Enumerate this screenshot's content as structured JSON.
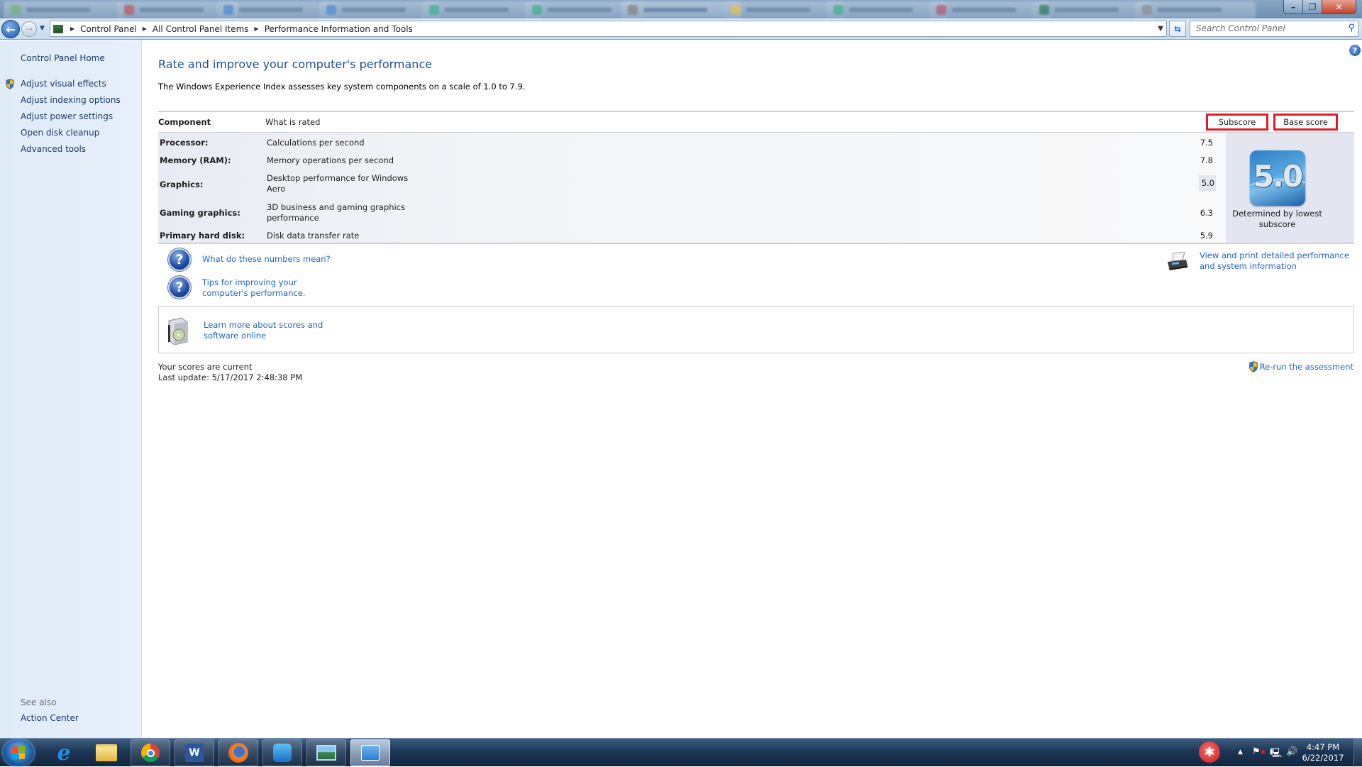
{
  "window": {
    "title_tabs_blurred": true,
    "controls": {
      "minimize": "–",
      "maximize": "❐",
      "close": "✕"
    }
  },
  "navbar": {
    "back_icon": "back-arrow-icon",
    "forward_icon": "forward-arrow-icon",
    "breadcrumbs": [
      "Control Panel",
      "All Control Panel Items",
      "Performance Information and Tools"
    ],
    "search_placeholder": "Search Control Panel"
  },
  "sidebar": {
    "home": "Control Panel Home",
    "items": [
      {
        "label": "Adjust visual effects",
        "shield": true
      },
      {
        "label": "Adjust indexing options",
        "shield": false
      },
      {
        "label": "Adjust power settings",
        "shield": false
      },
      {
        "label": "Open disk cleanup",
        "shield": false
      },
      {
        "label": "Advanced tools",
        "shield": false
      }
    ],
    "see_also_label": "See also",
    "see_also_items": [
      "Action Center"
    ]
  },
  "main": {
    "title": "Rate and improve your computer's performance",
    "intro": "The Windows Experience Index assesses key system components on a scale of 1.0 to 7.9.",
    "table": {
      "headers": {
        "component": "Component",
        "what": "What is rated",
        "subscore": "Subscore",
        "base": "Base score"
      },
      "rows": [
        {
          "component": "Processor:",
          "what": "Calculations per second",
          "subscore": "7.5"
        },
        {
          "component": "Memory (RAM):",
          "what": "Memory operations per second",
          "subscore": "7.8"
        },
        {
          "component": "Graphics:",
          "what": "Desktop performance for Windows Aero",
          "subscore": "5.0",
          "lowest": true
        },
        {
          "component": "Gaming graphics:",
          "what": "3D business and gaming graphics performance",
          "subscore": "6.3"
        },
        {
          "component": "Primary hard disk:",
          "what": "Disk data transfer rate",
          "subscore": "5.9"
        }
      ],
      "base_score": "5.0",
      "base_caption": "Determined by lowest subscore"
    },
    "links": {
      "numbers": "What do these numbers mean?",
      "tips": "Tips for improving your computer's performance.",
      "print": "View and print detailed performance and system information",
      "learn": "Learn more about scores and software online",
      "rerun": "Re-run the assessment"
    },
    "status": {
      "current": "Your scores are current",
      "last_update": "Last update: 5/17/2017 2:48:38 PM"
    }
  },
  "taskbar": {
    "apps": [
      "internet-explorer",
      "file-explorer",
      "chrome",
      "word",
      "firefox",
      "app-blue",
      "photo-viewer",
      "control-panel"
    ],
    "active_app": "control-panel",
    "clock_time": "4:47 PM",
    "clock_date": "6/22/2017"
  },
  "accent": {
    "link": "#1e63c8",
    "title": "#1e4e9a",
    "highlight_box": "#e31b23"
  }
}
